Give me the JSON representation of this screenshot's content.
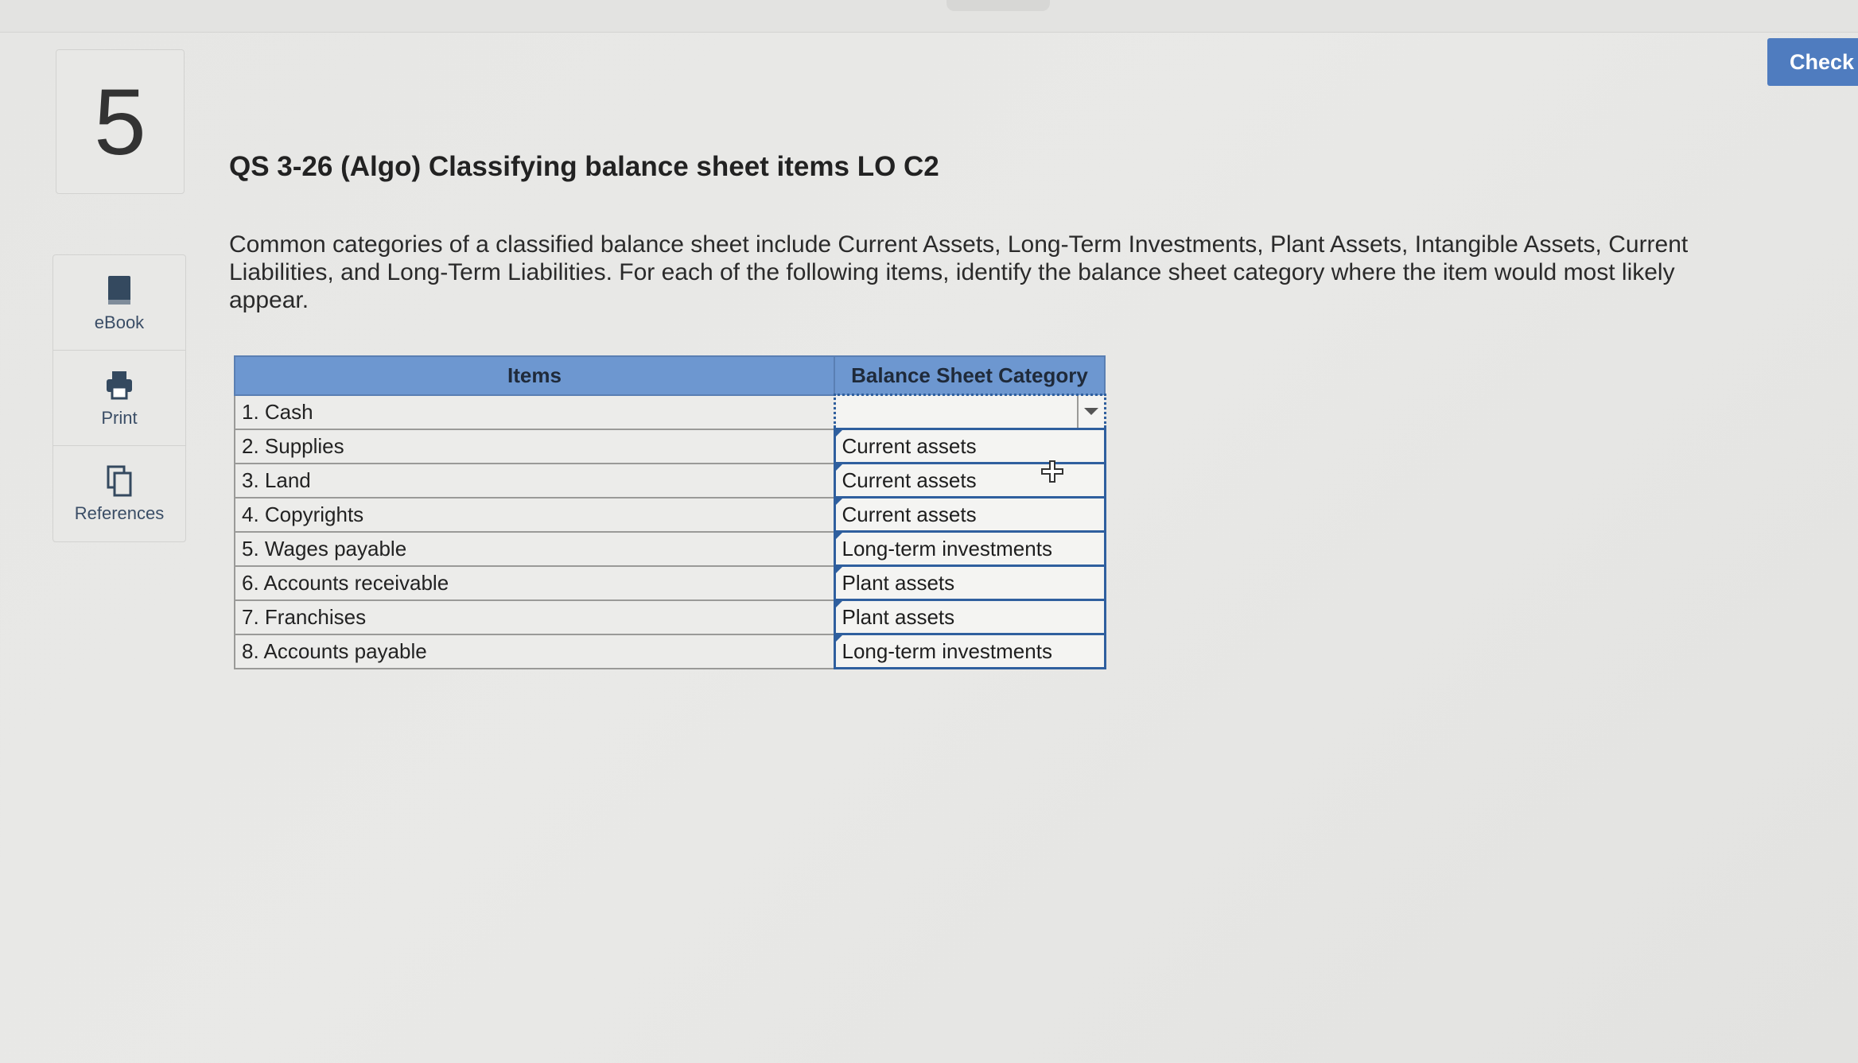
{
  "header": {
    "check_label": "Check"
  },
  "question": {
    "number": "5",
    "title": "QS 3-26 (Algo) Classifying balance sheet items LO C2",
    "instructions": "Common categories of a classified balance sheet include Current Assets, Long-Term Investments, Plant Assets, Intangible Assets, Current Liabilities, and Long-Term Liabilities. For each of the following items, identify the balance sheet category where the item would most likely appear."
  },
  "sidebar": {
    "items": [
      {
        "label": "eBook",
        "icon": "book-icon"
      },
      {
        "label": "Print",
        "icon": "printer-icon"
      },
      {
        "label": "References",
        "icon": "documents-icon"
      }
    ]
  },
  "table": {
    "headers": [
      "Items",
      "Balance Sheet Category"
    ],
    "rows": [
      {
        "item": "1. Cash",
        "category": ""
      },
      {
        "item": "2. Supplies",
        "category": "Current assets"
      },
      {
        "item": "3. Land",
        "category": "Current assets"
      },
      {
        "item": "4. Copyrights",
        "category": "Current assets"
      },
      {
        "item": "5. Wages payable",
        "category": "Long-term investments"
      },
      {
        "item": "6. Accounts receivable",
        "category": "Plant assets"
      },
      {
        "item": "7. Franchises",
        "category": "Plant assets"
      },
      {
        "item": "8. Accounts payable",
        "category": "Long-term investments"
      }
    ]
  },
  "colors": {
    "accent": "#4f7cbf",
    "table_header": "#6d97d0",
    "select_border": "#2f5f9e"
  }
}
